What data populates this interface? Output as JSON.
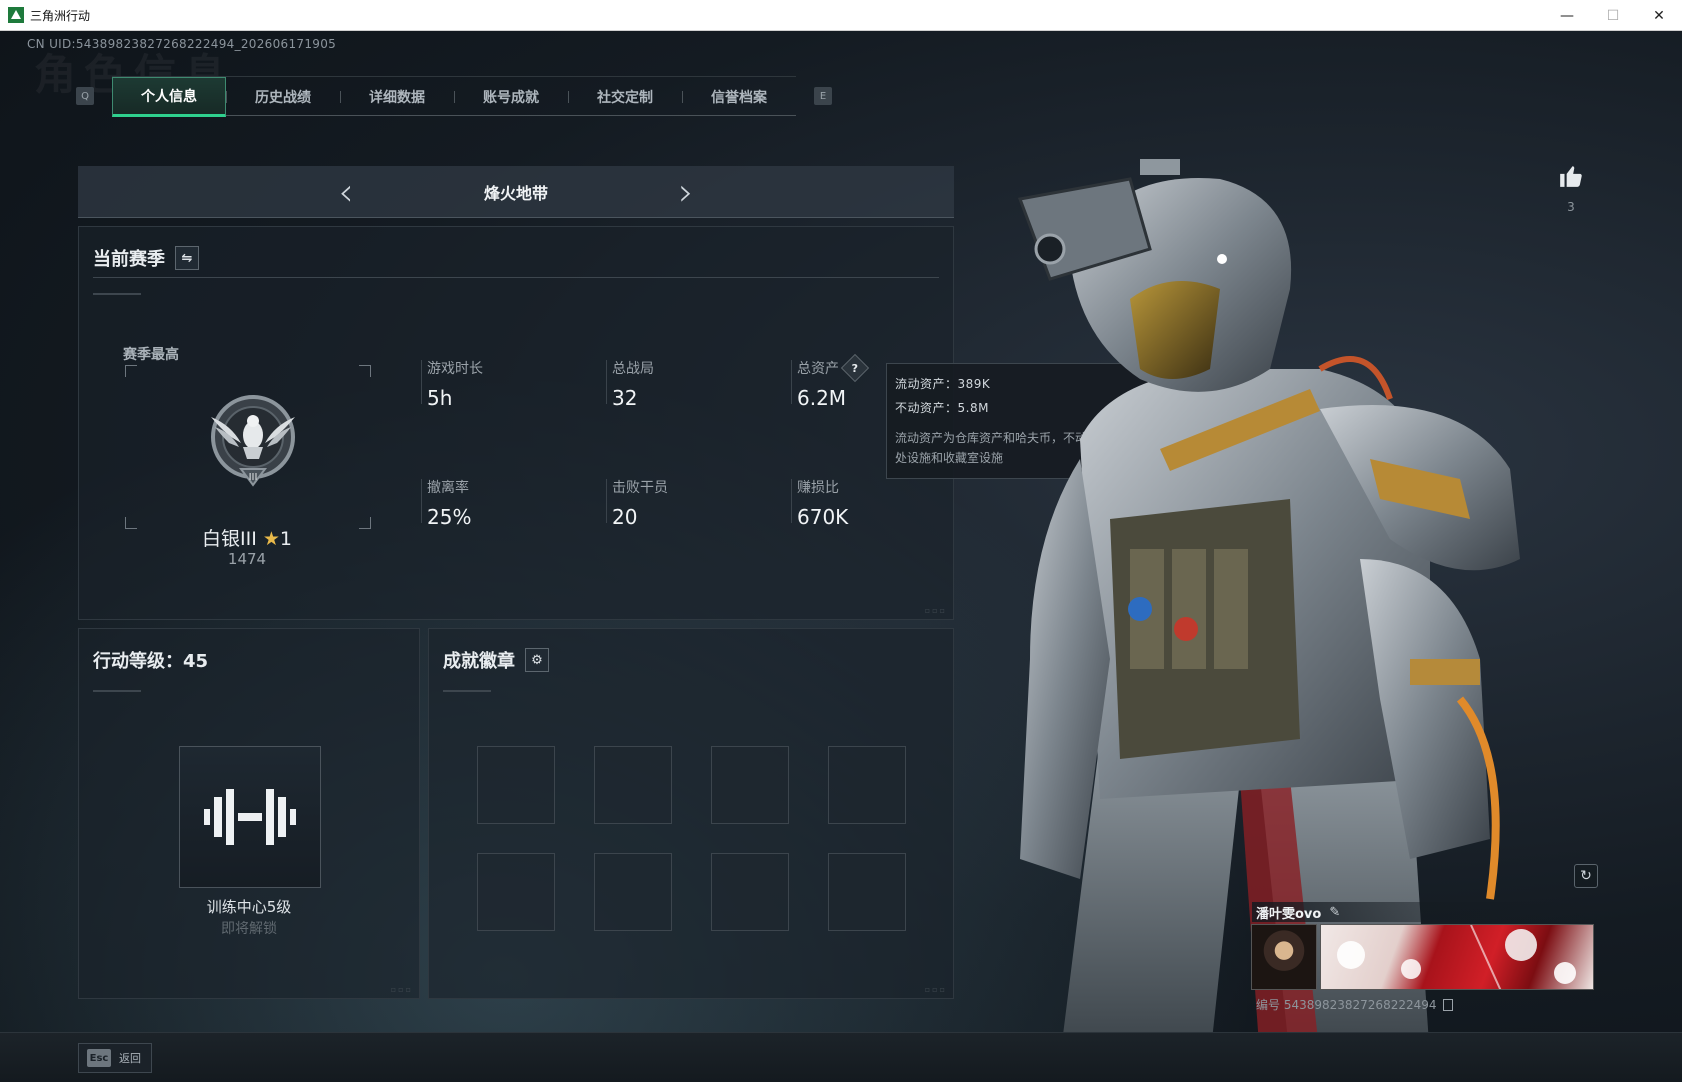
{
  "window": {
    "title": "三角洲行动",
    "controls": {
      "minimize": "—",
      "maximize": "☐",
      "close": "✕"
    }
  },
  "uid": "CN UID:5438982382726822249​4_202606171905",
  "background_watermark": "角色信息",
  "tabs": {
    "left_key": "Q",
    "right_key": "E",
    "items": [
      {
        "label": "个人信息",
        "active": true
      },
      {
        "label": "历史战绩",
        "active": false
      },
      {
        "label": "详细数据",
        "active": false
      },
      {
        "label": "账号成就",
        "active": false
      },
      {
        "label": "社交定制",
        "active": false
      },
      {
        "label": "信誉档案",
        "active": false
      }
    ]
  },
  "mode": {
    "title": "烽火地带",
    "prev_icon": "chevron-left-icon",
    "next_icon": "chevron-right-icon"
  },
  "season": {
    "title": "当前赛季",
    "switch_icon": "swap-icon",
    "rank_label": "赛季最高",
    "rank_name": "白银III",
    "rank_stars": "1",
    "rank_score": "1474",
    "badge_numeral": "III",
    "stats": [
      {
        "label": "游戏时长",
        "value": "5h"
      },
      {
        "label": "总战局",
        "value": "32"
      },
      {
        "label": "总资产",
        "value": "6.2M",
        "help": "?"
      },
      {
        "label": "撤离率",
        "value": "25%"
      },
      {
        "label": "击败干员",
        "value": "20"
      },
      {
        "label": "赚损比",
        "value": "670K"
      }
    ]
  },
  "tooltip": {
    "liquid": "流动资产：389K",
    "fixed": "不动资产：5.8M",
    "desc": "流动资产为仓库资产和哈夫币，不动资产为特勤处设施和收藏室设施"
  },
  "level": {
    "title": "行动等级：45",
    "icon": "dumbbell-icon",
    "caption": "训练中心5级",
    "status": "即将解锁"
  },
  "badges": {
    "title": "成就徽章",
    "settings_icon": "gear-icon",
    "slot_count": 8
  },
  "profile": {
    "like_count": "3",
    "name": "潘叶雯ovo",
    "id_text": "编号 5438982382726822249​4"
  },
  "footer": {
    "esc_key": "Esc",
    "esc_label": "返回"
  },
  "colors": {
    "accent": "#2fd18e",
    "panel_bg": "#1a222a",
    "gold": "#e8b94a"
  }
}
